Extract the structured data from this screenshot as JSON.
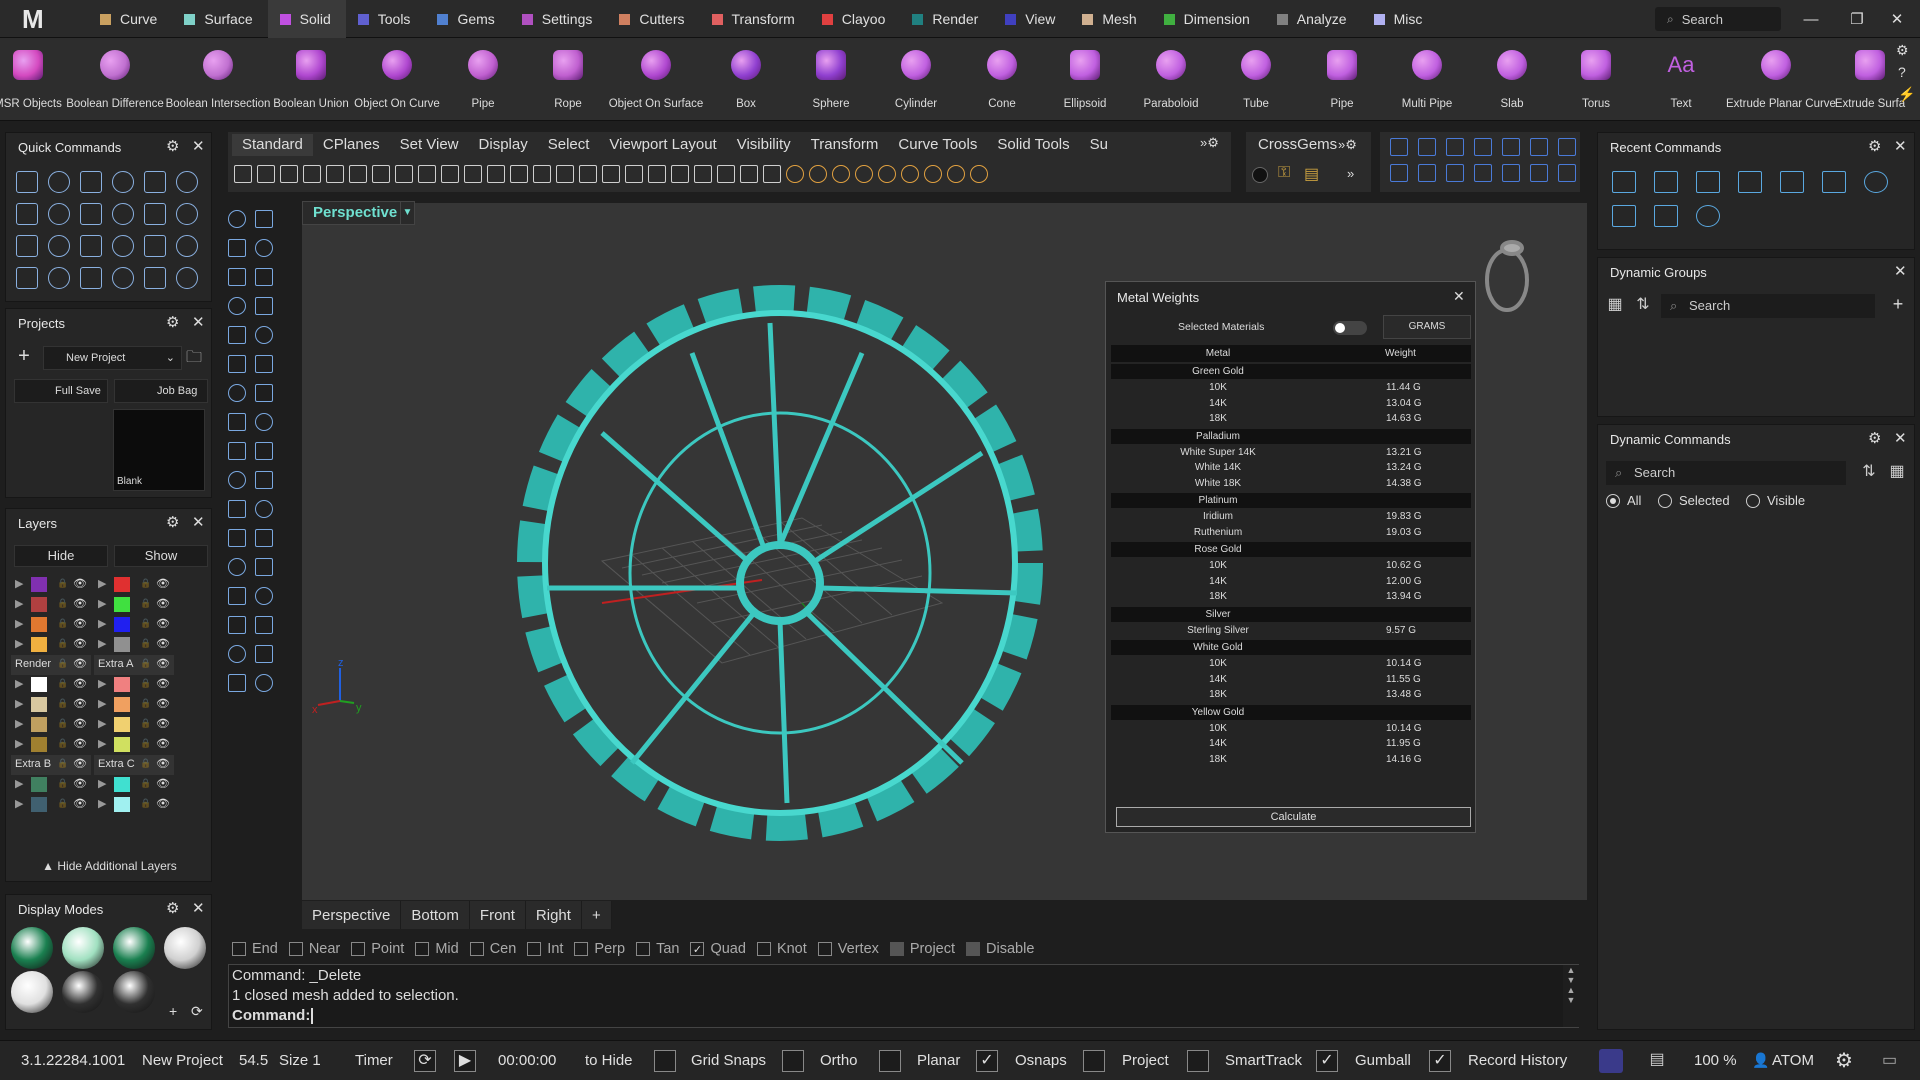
{
  "app": {
    "logo": "M"
  },
  "menubar": {
    "items": [
      {
        "label": "Curve",
        "color": "#c9a060"
      },
      {
        "label": "Surface",
        "color": "#7fd1c8"
      },
      {
        "label": "Solid",
        "color": "#c050e0"
      },
      {
        "label": "Tools",
        "color": "#6060d0"
      },
      {
        "label": "Gems",
        "color": "#5080d0"
      },
      {
        "label": "Settings",
        "color": "#b050c0"
      },
      {
        "label": "Cutters",
        "color": "#d08060"
      },
      {
        "label": "Transform",
        "color": "#e06060"
      },
      {
        "label": "Clayoo",
        "color": "#e04040"
      },
      {
        "label": "Render",
        "color": "#208080"
      },
      {
        "label": "View",
        "color": "#4040c0"
      },
      {
        "label": "Mesh",
        "color": "#d0b090"
      },
      {
        "label": "Dimension",
        "color": "#40b040"
      },
      {
        "label": "Analyze",
        "color": "#808080"
      },
      {
        "label": "Misc",
        "color": "#b0b0f0"
      }
    ],
    "active": "Solid",
    "search_placeholder": "Search"
  },
  "ribbon": {
    "items": [
      {
        "label": "MSR Objects",
        "icon": "msr-objects-icon"
      },
      {
        "label": "Boolean Difference",
        "icon": "boolean-difference-icon"
      },
      {
        "label": "Boolean Intersection",
        "icon": "boolean-intersection-icon"
      },
      {
        "label": "Boolean Union",
        "icon": "boolean-union-icon"
      },
      {
        "label": "Object On Curve",
        "icon": "object-on-curve-icon"
      },
      {
        "label": "Pipe",
        "icon": "pipe-icon"
      },
      {
        "label": "Rope",
        "icon": "rope-icon"
      },
      {
        "label": "Object On Surface",
        "icon": "object-on-surface-icon"
      },
      {
        "label": "Box",
        "icon": "box-icon"
      },
      {
        "label": "Sphere",
        "icon": "sphere-icon"
      },
      {
        "label": "Cylinder",
        "icon": "cylinder-icon"
      },
      {
        "label": "Cone",
        "icon": "cone-icon"
      },
      {
        "label": "Ellipsoid",
        "icon": "ellipsoid-icon"
      },
      {
        "label": "Paraboloid",
        "icon": "paraboloid-icon"
      },
      {
        "label": "Tube",
        "icon": "tube-icon"
      },
      {
        "label": "Pipe",
        "icon": "pipe-icon"
      },
      {
        "label": "Multi Pipe",
        "icon": "multi-pipe-icon"
      },
      {
        "label": "Slab",
        "icon": "slab-icon"
      },
      {
        "label": "Torus",
        "icon": "torus-icon"
      },
      {
        "label": "Text",
        "icon": "text-icon",
        "glyph": "Aa"
      },
      {
        "label": "Extrude Planar Curve",
        "icon": "extrude-planar-curve-icon"
      },
      {
        "label": "Extrude Surfa",
        "icon": "extrude-surface-icon"
      }
    ]
  },
  "panels": {
    "quick_commands": "Quick Commands",
    "projects": {
      "title": "Projects",
      "project_name": "New Project",
      "full_save": "Full Save",
      "job_bag": "Job Bag",
      "thumb_label": "Blank"
    },
    "layers": {
      "title": "Layers",
      "hide": "Hide",
      "show": "Show",
      "render": "Render",
      "extra_a": "Extra A",
      "extra_b": "Extra B",
      "extra_c": "Extra C",
      "hide_additional": "Hide Additional Layers"
    },
    "display_modes": "Display Modes",
    "recent_commands": "Recent Commands",
    "dynamic_groups": {
      "title": "Dynamic Groups",
      "search": "Search"
    },
    "dynamic_commands": {
      "title": "Dynamic Commands",
      "search": "Search",
      "opt_all": "All",
      "opt_selected": "Selected",
      "opt_visible": "Visible"
    }
  },
  "toolbar_tabs": [
    "Standard",
    "CPlanes",
    "Set View",
    "Display",
    "Select",
    "Viewport Layout",
    "Visibility",
    "Transform",
    "Curve Tools",
    "Solid Tools",
    "Su"
  ],
  "crossgems_tab": "CrossGems",
  "viewport": {
    "name": "Perspective"
  },
  "metal_weights": {
    "title": "Metal Weights",
    "selected_materials": "Selected Materials",
    "units": "GRAMS",
    "col_metal": "Metal",
    "col_weight": "Weight",
    "calculate": "Calculate",
    "groups": [
      {
        "name": "Green Gold",
        "rows": [
          [
            "10K",
            "11.44 G"
          ],
          [
            "14K",
            "13.04 G"
          ],
          [
            "18K",
            "14.63 G"
          ]
        ]
      },
      {
        "name": "Palladium",
        "rows": [
          [
            "White Super 14K",
            "13.21 G"
          ],
          [
            "White 14K",
            "13.24 G"
          ],
          [
            "White 18K",
            "14.38 G"
          ]
        ]
      },
      {
        "name": "Platinum",
        "rows": [
          [
            "Iridium",
            "19.83 G"
          ],
          [
            "Ruthenium",
            "19.03 G"
          ]
        ]
      },
      {
        "name": "Rose Gold",
        "rows": [
          [
            "10K",
            "10.62 G"
          ],
          [
            "14K",
            "12.00 G"
          ],
          [
            "18K",
            "13.94 G"
          ]
        ]
      },
      {
        "name": "Silver",
        "rows": [
          [
            "Sterling Silver",
            "9.57 G"
          ]
        ]
      },
      {
        "name": "White Gold",
        "rows": [
          [
            "10K",
            "10.14 G"
          ],
          [
            "14K",
            "11.55 G"
          ],
          [
            "18K",
            "13.48 G"
          ]
        ]
      },
      {
        "name": "Yellow Gold",
        "rows": [
          [
            "10K",
            "10.14 G"
          ],
          [
            "14K",
            "11.95 G"
          ],
          [
            "18K",
            "14.16 G"
          ]
        ]
      }
    ]
  },
  "bottom_tabs": [
    "Perspective",
    "Bottom",
    "Front",
    "Right"
  ],
  "osnaps": [
    {
      "label": "End",
      "checked": false
    },
    {
      "label": "Near",
      "checked": false
    },
    {
      "label": "Point",
      "checked": false
    },
    {
      "label": "Mid",
      "checked": false
    },
    {
      "label": "Cen",
      "checked": false
    },
    {
      "label": "Int",
      "checked": false
    },
    {
      "label": "Perp",
      "checked": false
    },
    {
      "label": "Tan",
      "checked": false
    },
    {
      "label": "Quad",
      "checked": true
    },
    {
      "label": "Knot",
      "checked": false
    },
    {
      "label": "Vertex",
      "checked": false
    },
    {
      "label": "Project",
      "checked": false
    },
    {
      "label": "Disable",
      "checked": false
    }
  ],
  "command": {
    "line1": "Command: _Delete",
    "line2": "1 closed mesh added to selection.",
    "prompt": "Command:"
  },
  "status": {
    "version": "3.1.22284.1001",
    "project": "New Project",
    "value1": "54.5",
    "size": "Size 1",
    "timer": "Timer",
    "time": "00:00:00",
    "to_hide": "to Hide",
    "grid_snaps": "Grid Snaps",
    "ortho": "Ortho",
    "planar": "Planar",
    "osnaps": "Osnaps",
    "project_toggle": "Project",
    "smarttrack": "SmartTrack",
    "gumball": "Gumball",
    "record_history": "Record History",
    "zoom": "100 %",
    "user": "ATOM"
  },
  "colors": {
    "accent": "#2ecbc0",
    "model": "#3cc8c0"
  }
}
